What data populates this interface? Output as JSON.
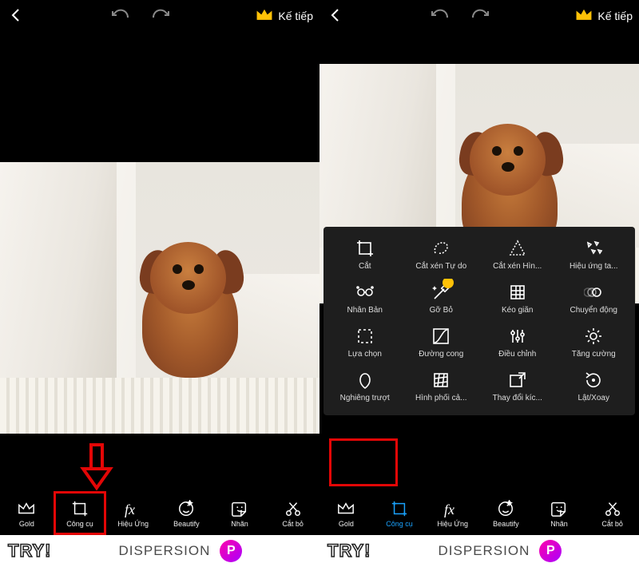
{
  "header": {
    "next_label": "Kế tiếp"
  },
  "bottom_nav": {
    "items": [
      {
        "label": "Gold",
        "icon": "crown-icon"
      },
      {
        "label": "Công cụ",
        "icon": "crop-icon"
      },
      {
        "label": "Hiệu Ứng",
        "icon": "fx-icon"
      },
      {
        "label": "Beautify",
        "icon": "beautify-icon"
      },
      {
        "label": "Nhãn",
        "icon": "sticker-icon"
      },
      {
        "label": "Cắt bỏ",
        "icon": "cutout-icon"
      }
    ],
    "highlighted_left": 1,
    "active_right": 1
  },
  "tool_panel": {
    "rows": [
      [
        {
          "label": "Cắt",
          "icon": "crop-icon"
        },
        {
          "label": "Cắt xén Tự do",
          "icon": "lasso-icon"
        },
        {
          "label": "Cắt xén Hìn...",
          "icon": "shape-crop-icon"
        },
        {
          "label": "Hiệu ứng ta...",
          "icon": "disperse-icon"
        }
      ],
      [
        {
          "label": "Nhân Bản",
          "icon": "clone-icon"
        },
        {
          "label": "Gỡ Bỏ",
          "icon": "remove-icon",
          "gold": true
        },
        {
          "label": "Kéo giãn",
          "icon": "stretch-icon"
        },
        {
          "label": "Chuyển động",
          "icon": "motion-icon"
        }
      ],
      [
        {
          "label": "Lựa chọn",
          "icon": "select-icon"
        },
        {
          "label": "Đường cong",
          "icon": "curves-icon"
        },
        {
          "label": "Điều chỉnh",
          "icon": "adjust-icon"
        },
        {
          "label": "Tăng cường",
          "icon": "enhance-icon"
        }
      ],
      [
        {
          "label": "Nghiêng trượt",
          "icon": "tiltshift-icon",
          "highlighted": true
        },
        {
          "label": "Hình phối cả...",
          "icon": "perspective-icon"
        },
        {
          "label": "Thay đổi kíc...",
          "icon": "resize-icon"
        },
        {
          "label": "Lật/Xoay",
          "icon": "fliprotate-icon"
        }
      ]
    ]
  },
  "ad": {
    "try_label": "TRY!",
    "dispersion_label": "DISPERSION",
    "logo_letter": "P"
  }
}
